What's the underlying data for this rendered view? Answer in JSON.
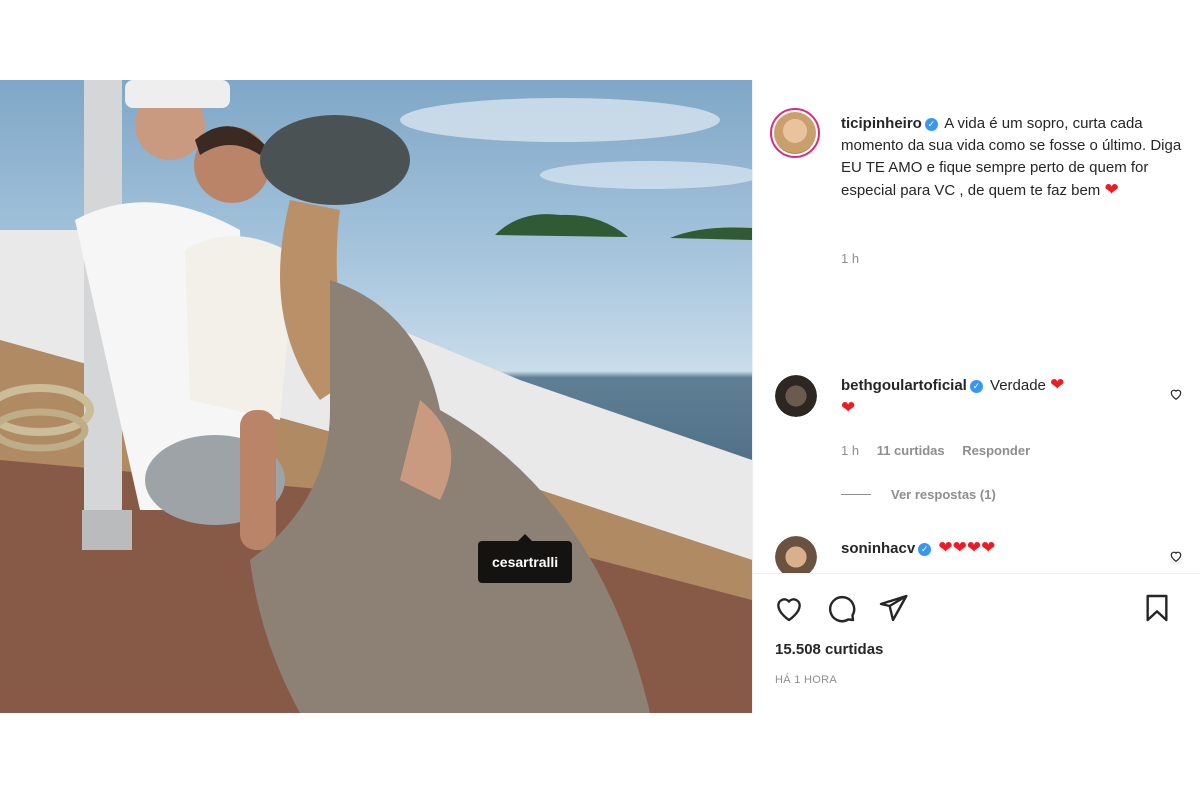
{
  "post": {
    "photo_tag": "cesartralli",
    "caption": {
      "username": "ticipinheiro",
      "text": "A vida é um sopro, curta cada momento da sua vida como se fosse o último. Diga EU TE AMO e fique sempre perto de quem for especial para VC , de quem te faz bem",
      "emoji": "❤",
      "time": "1 h"
    },
    "comments": [
      {
        "username": "bethgoulartoficial",
        "text": "Verdade",
        "emoji_after": "❤",
        "emoji_line2": "❤",
        "time": "1 h",
        "likes": "11 curtidas",
        "reply_label": "Responder",
        "view_replies": "Ver respostas (1)"
      },
      {
        "username": "soninhacv",
        "emojis": "❤❤❤❤"
      }
    ],
    "likes_count": "15.508 curtidas",
    "posted_ago": "HÁ 1 HORA"
  },
  "icons": {
    "like": "heart-outline-icon",
    "comment": "comment-bubble-icon",
    "share": "paper-plane-icon",
    "save": "bookmark-icon",
    "verified": "verified-badge-icon",
    "comment_like": "small-heart-icon"
  },
  "colors": {
    "verified": "#3897f0",
    "heart_emoji": "#ed1c24",
    "muted": "#8e8e8e",
    "text": "#262626",
    "story_ring": "#dd2a7b"
  }
}
